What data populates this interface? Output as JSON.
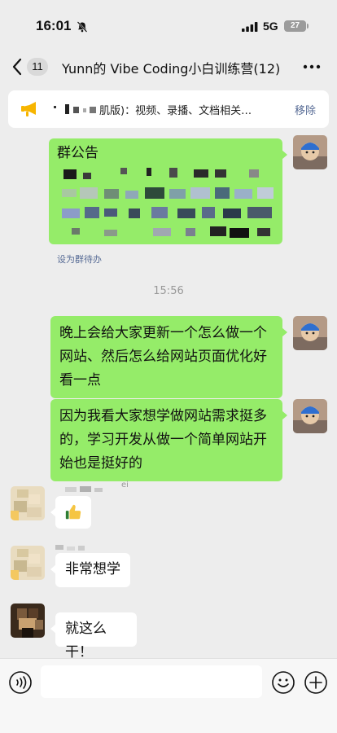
{
  "status": {
    "time": "16:01",
    "network": "5G",
    "battery": "27"
  },
  "nav": {
    "unread_count": "11",
    "title": "Yunn的 Vibe Coding小白训练营(12)"
  },
  "notice": {
    "text": "肌版)：视频、录播、文档相关…",
    "remove_label": "移除"
  },
  "messages": {
    "announcement_title": "群公告",
    "todo_link": "设为群待办",
    "timestamp": "15:56",
    "m1": "晚上会给大家更新一个怎么做一个网站、然后怎么给网站页面优化好看一点",
    "m2": "因为我看大家想学做网站需求挺多的，学习开发从做一个简单网站开始也是挺好的",
    "m3_sender": "ei",
    "m4": "非常想学",
    "m5": "就这么干！"
  },
  "icons": [
    "bell-slash-icon",
    "signal-icon",
    "back-chevron-icon",
    "more-icon",
    "megaphone-icon",
    "thumbs-up-icon",
    "voice-icon",
    "emoji-icon",
    "plus-icon"
  ],
  "colors": {
    "bubble_out": "#95ec69",
    "bubble_in": "#ffffff",
    "link": "#576b95",
    "background": "#ededed"
  }
}
